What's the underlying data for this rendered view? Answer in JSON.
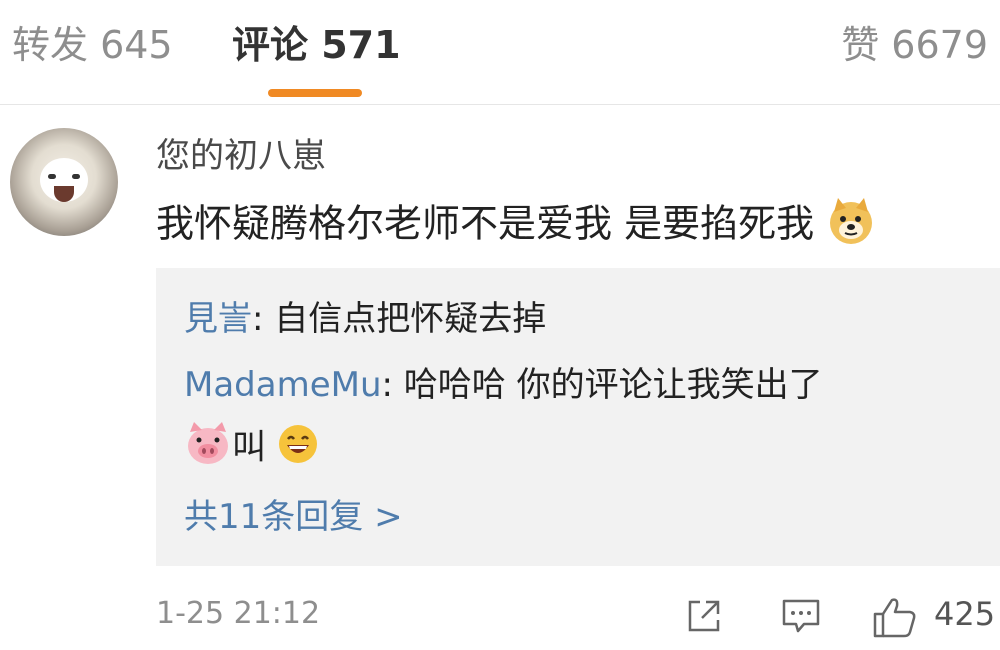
{
  "tabs": {
    "repost": "转发 645",
    "comment": "评论 571",
    "like": "赞 6679"
  },
  "comment": {
    "username": "您的初八崽",
    "text": "我怀疑腾格尔老师不是爱我 是要掐死我",
    "emoji_icon": "doge-icon",
    "replies": [
      {
        "user": "見訔",
        "sep": ":",
        "text": " 自信点把怀疑去掉"
      },
      {
        "user": "MadameMu",
        "sep": ":",
        "text": " 哈哈哈 你的评论让我笑出了",
        "continuation": "叫",
        "icons": [
          "pig-face-icon",
          "laughing-icon"
        ]
      }
    ],
    "more_replies": "共11条回复 >",
    "timestamp": "1-25 21:12",
    "like_count": "425"
  },
  "colors": {
    "accent": "#f08a24",
    "link": "#4f7cac",
    "reply_bg": "#f2f2f2"
  }
}
